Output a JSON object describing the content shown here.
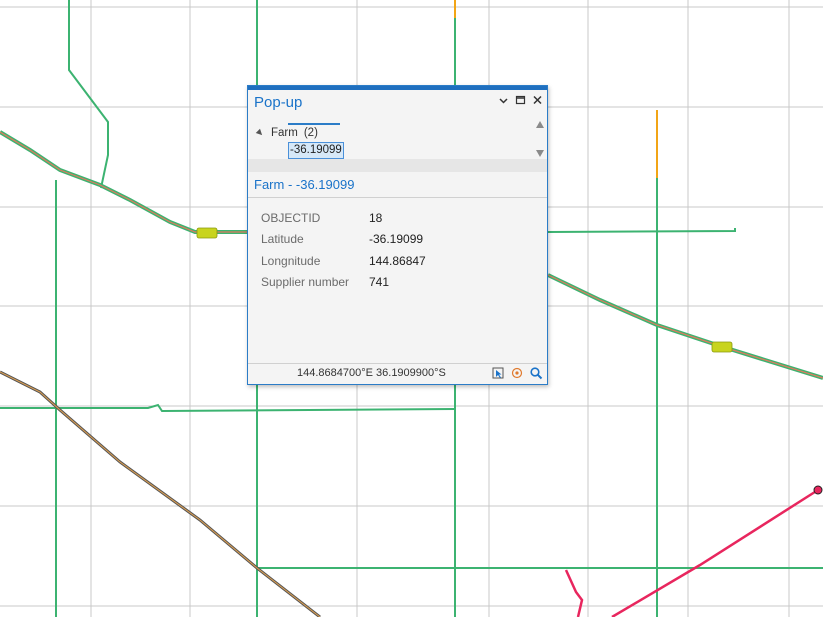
{
  "map": {
    "grid_color": "#c8c8c8",
    "road_color": "#3cb371",
    "highway_color": "#e07a5f",
    "railway_color": "#555555",
    "pink_line_color": "#e8265e",
    "orange_line_color": "#f2a516",
    "route_shield_color": "#c8d41e"
  },
  "popup": {
    "title": "Pop-up",
    "controls": {
      "menu": "chevron-down",
      "restore": "restore",
      "close": "close"
    },
    "tree": {
      "layer_label": "Farm",
      "layer_count": "(2)",
      "selected_item": "-36.19099"
    },
    "feature_title": "Farm - -36.19099",
    "attributes": [
      {
        "key": "OBJECTID",
        "value": "18"
      },
      {
        "key": "Latitude",
        "value": "-36.19099"
      },
      {
        "key": "Longnitude",
        "value": "144.86847"
      },
      {
        "key": "Supplier number",
        "value": "741"
      }
    ],
    "footer": {
      "coordinates": "144.8684700°E 36.1909900°S",
      "icons": [
        "select-icon",
        "flash-icon",
        "zoom-icon"
      ]
    }
  }
}
